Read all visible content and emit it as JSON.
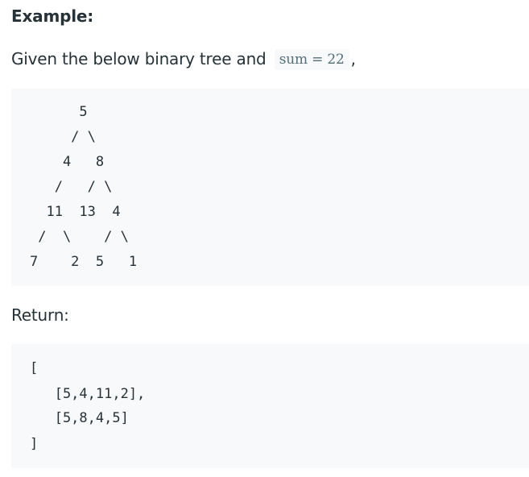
{
  "heading": "Example:",
  "intro": {
    "text": "Given the below binary tree and",
    "code": "sum = 22",
    "trailing": ","
  },
  "tree_lines": [
    "      5",
    "     / \\",
    "    4   8",
    "   /   / \\",
    "  11  13  4",
    " /  \\    / \\",
    "7    2  5   1"
  ],
  "return_label": "Return:",
  "result_lines": [
    "[",
    "   [5,4,11,2],",
    "   [5,8,4,5]",
    "]"
  ]
}
